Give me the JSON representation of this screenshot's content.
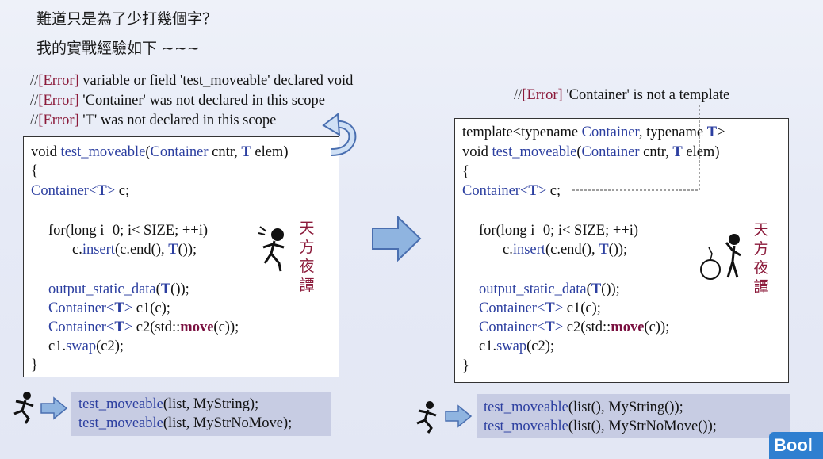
{
  "title_line1": "難道只是為了少打幾個字？",
  "title_line2": "我的實戰經驗如下 ~~~",
  "left": {
    "errors": [
      {
        "prefix": "//",
        "tag": "[Error]",
        "text": " variable or field 'test_moveable' declared void"
      },
      {
        "prefix": "//",
        "tag": "[Error]",
        "text": " 'Container' was not declared in this scope"
      },
      {
        "prefix": "//",
        "tag": "[Error]",
        "text": " 'T' was not declared in this scope"
      }
    ],
    "code": {
      "l1_a": "void ",
      "l1_fn": "test_moveable",
      "l1_b": "(",
      "l1_c": "Container",
      "l1_d": " cntr, ",
      "l1_T": "T",
      "l1_e": " elem)",
      "brace_open": "{",
      "l3_c": "Container",
      "l3_lt": "<",
      "l3_T": "T",
      "l3_gt": ">",
      "l3_rest": " c;",
      "l5": "for(long i=0; i< SIZE; ++i)",
      "l6_a": "c.",
      "l6_fn": "insert",
      "l6_b": "(c.end(), ",
      "l6_T": "T",
      "l6_c": "());",
      "l8_fn": "output_static_data",
      "l8_b": "(",
      "l8_T": "T",
      "l8_c": "());",
      "l9_c": "Container",
      "l9_lt": "<",
      "l9_T": "T",
      "l9_gt": ">",
      "l9_rest": " c1(c);",
      "l10_c": "Container",
      "l10_lt": "<",
      "l10_T": "T",
      "l10_gt": ">",
      "l10_a": " c2(std::",
      "l10_mv": "move",
      "l10_b": "(c));",
      "l11_a": "c1.",
      "l11_fn": "swap",
      "l11_b": "(c2);",
      "brace_close": "}"
    },
    "cjk": [
      "天",
      "方",
      "夜",
      "譚"
    ],
    "calls": [
      {
        "fn": "test_moveable",
        "a": "(",
        "s": "list",
        "b": ", MyString);"
      },
      {
        "fn": "test_moveable",
        "a": "(",
        "s": "list",
        "b": ", MyStrNoMove);"
      }
    ]
  },
  "right": {
    "error": {
      "prefix": "//",
      "tag": "[Error]",
      "text": " 'Container' is not a template"
    },
    "code": {
      "l0_a": "template<typename ",
      "l0_c": "Container",
      "l0_b": ", typename ",
      "l0_T": "T",
      "l0_e": ">",
      "l1_a": "void ",
      "l1_fn": "test_moveable",
      "l1_b": "(",
      "l1_c": "Container",
      "l1_d": " cntr, ",
      "l1_T": "T",
      "l1_e": " elem)",
      "brace_open": "{",
      "l3_c": "Container",
      "l3_lt": "<",
      "l3_T": "T",
      "l3_gt": ">",
      "l3_rest": " c;",
      "l5": "for(long i=0; i< SIZE; ++i)",
      "l6_a": "c.",
      "l6_fn": "insert",
      "l6_b": "(c.end(), ",
      "l6_T": "T",
      "l6_c": "());",
      "l8_fn": "output_static_data",
      "l8_b": "(",
      "l8_T": "T",
      "l8_c": "());",
      "l9_c": "Container",
      "l9_lt": "<",
      "l9_T": "T",
      "l9_gt": ">",
      "l9_rest": " c1(c);",
      "l10_c": "Container",
      "l10_lt": "<",
      "l10_T": "T",
      "l10_gt": ">",
      "l10_a": " c2(std::",
      "l10_mv": "move",
      "l10_b": "(c));",
      "l11_a": "c1.",
      "l11_fn": "swap",
      "l11_b": "(c2);",
      "brace_close": "}"
    },
    "cjk": [
      "天",
      "方",
      "夜",
      "譚"
    ],
    "calls": [
      {
        "fn": "test_moveable",
        "a": "(list(), MyString());"
      },
      {
        "fn": "test_moveable",
        "a": "(list(), MyStrNoMove());"
      }
    ]
  },
  "logo": "Bool",
  "colors": {
    "error_tag": "#8b1a3a",
    "keyword_blue": "#2c3fa0",
    "move_red": "#7a1040",
    "call_box": "#c7cce3",
    "arrow_blue": "#7fa8dc"
  }
}
